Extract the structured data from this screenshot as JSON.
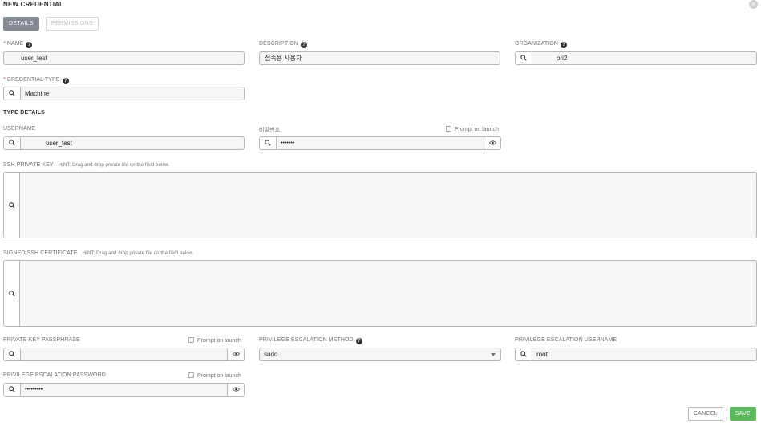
{
  "header": {
    "title": "NEW CREDENTIAL"
  },
  "tabs": [
    {
      "label": "DETAILS",
      "active": true
    },
    {
      "label": "PERMISSIONS",
      "active": false
    }
  ],
  "fields": {
    "name": {
      "label": "NAME",
      "value": "user_test"
    },
    "description": {
      "label": "DESCRIPTION",
      "value": "접속용 사용자"
    },
    "organization": {
      "label": "ORGANIZATION",
      "value": "ori2"
    },
    "credential_type": {
      "label": "CREDENTIAL TYPE",
      "value": "Machine"
    }
  },
  "type_details": {
    "title": "TYPE DETAILS",
    "username": {
      "label": "USERNAME",
      "value": "user_test"
    },
    "password": {
      "label": "비밀번호",
      "value": "•••••••",
      "prompt_label": "Prompt on launch"
    },
    "ssh_private_key": {
      "label": "SSH PRIVATE KEY",
      "hint": "HINT: Drag and drop private file on the field below."
    },
    "signed_ssh_certificate": {
      "label": "SIGNED SSH CERTIFICATE",
      "hint": "HINT: Drag and drop private file on the field below."
    },
    "private_key_passphrase": {
      "label": "PRIVATE KEY PASSPHRASE",
      "value": "",
      "prompt_label": "Prompt on launch"
    },
    "privilege_escalation_method": {
      "label": "PRIVILEGE ESCALATION METHOD",
      "value": "sudo"
    },
    "privilege_escalation_username": {
      "label": "PRIVILEGE ESCALATION USERNAME",
      "value": "root"
    },
    "privilege_escalation_password": {
      "label": "PRIVILEGE ESCALATION PASSWORD",
      "value": "•••••••••",
      "prompt_label": "Prompt on launch"
    }
  },
  "actions": {
    "cancel_label": "CANCEL",
    "save_label": "SAVE"
  },
  "colors": {
    "save": "#5cb85c",
    "tab_active": "#848992",
    "required": "#d9534f"
  },
  "icons": {
    "search": "search-icon",
    "eye": "eye-icon",
    "help": "question-circle-icon",
    "close": "close-icon"
  }
}
